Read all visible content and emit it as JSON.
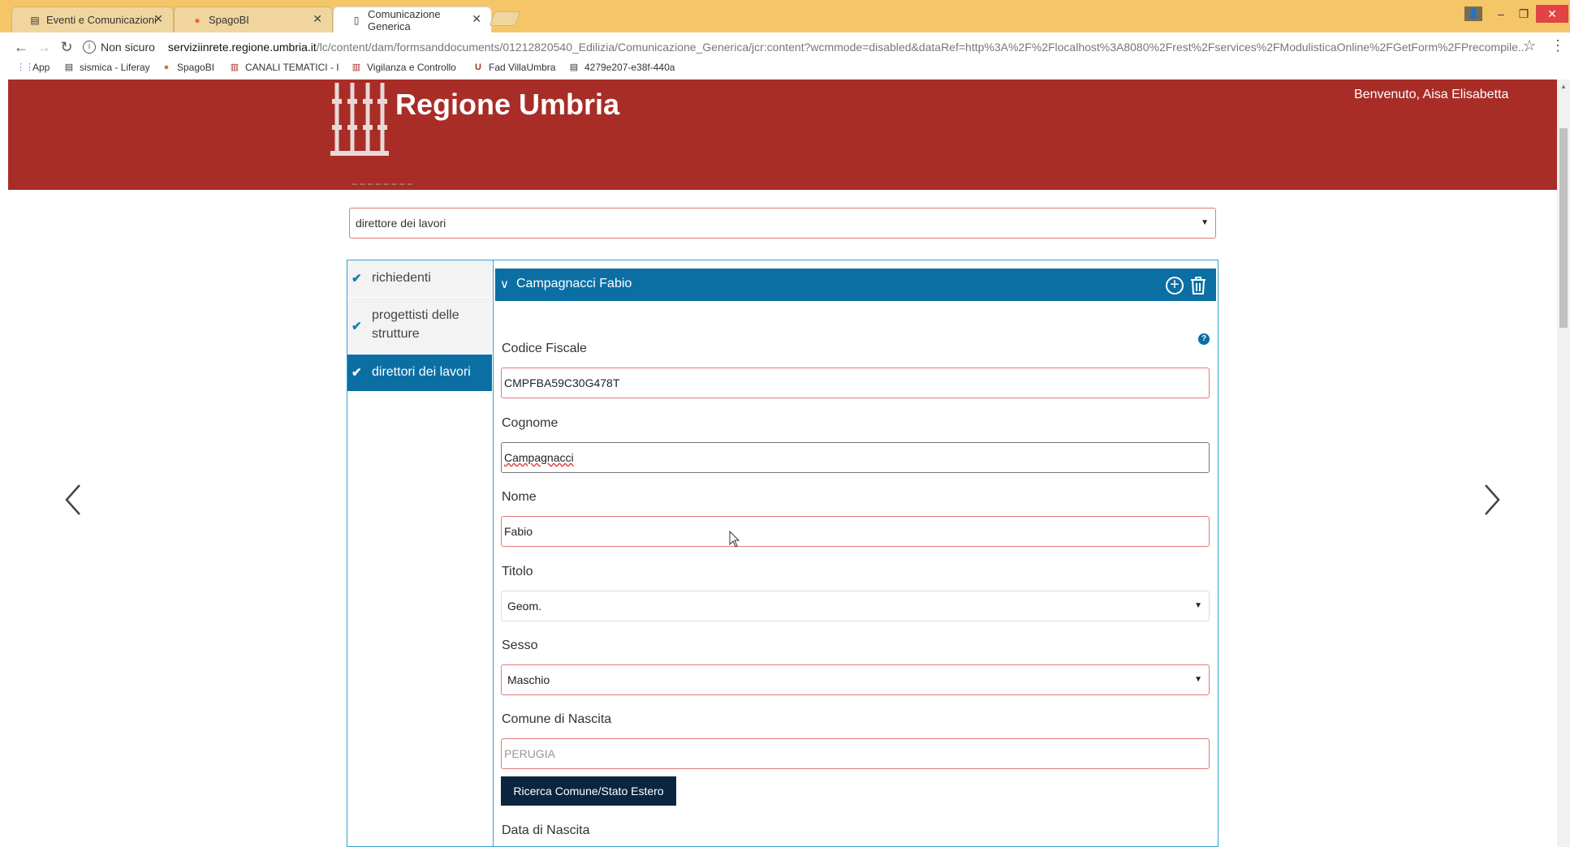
{
  "browser": {
    "tabs": [
      {
        "title": "Eventi e Comunicazioni",
        "icon": "page-icon"
      },
      {
        "title": "SpagoBI",
        "icon": "spagobi-icon"
      },
      {
        "title": "Comunicazione Generica",
        "icon": "document-icon"
      }
    ],
    "address": {
      "security_label": "Non sicuro",
      "host": "serviziinrete.regione.umbria.it",
      "path": "/lc/content/dam/formsanddocuments/01212820540_Edilizia/Comunicazione_Generica/jcr:content?wcmmode=disabled&dataRef=http%3A%2F%2Flocalhost%3A8080%2Frest%2Fservices%2FModulisticaOnline%2FGetForm%2FPrecompile..."
    },
    "bookmarks": [
      {
        "label": "App",
        "icon": "apps-grid-icon"
      },
      {
        "label": "sismica - Liferay",
        "icon": "page-icon"
      },
      {
        "label": "SpagoBI",
        "icon": "spagobi-icon"
      },
      {
        "label": "CANALI TEMATICI - I",
        "icon": "regione-icon"
      },
      {
        "label": "Vigilanza e Controllo",
        "icon": "regione-icon"
      },
      {
        "label": "Fad VillaUmbra",
        "icon": "u-icon"
      },
      {
        "label": "4279e207-e38f-440a",
        "icon": "page-icon"
      }
    ]
  },
  "header": {
    "brand": "Regione Umbria",
    "welcome": "Benvenuto, Aisa Elisabetta"
  },
  "form": {
    "role_select": "direttore dei lavori",
    "sections": [
      {
        "label": "richiedenti",
        "active": false
      },
      {
        "label": "progettisti delle strutture",
        "active": false
      },
      {
        "label": "direttori dei lavori",
        "active": true
      }
    ],
    "panel_title": "Campagnacci Fabio",
    "help_icon_text": "?",
    "fields": {
      "codice_fiscale": {
        "label": "Codice Fiscale",
        "value": "CMPFBA59C30G478T"
      },
      "cognome": {
        "label": "Cognome",
        "value": "Campagnacci"
      },
      "nome": {
        "label": "Nome",
        "value": "Fabio"
      },
      "titolo": {
        "label": "Titolo",
        "value": "Geom."
      },
      "sesso": {
        "label": "Sesso",
        "value": "Maschio"
      },
      "comune_nascita": {
        "label": "Comune di Nascita",
        "value": "PERUGIA"
      },
      "data_nascita": {
        "label": "Data di Nascita"
      }
    },
    "search_button": "Ricerca Comune/Stato Estero"
  },
  "colors": {
    "header_red": "#a82d27",
    "accent_blue": "#0b6fa4",
    "tabstrip": "#f5c668",
    "error_border": "#e07a7a",
    "button_dark": "#0a2540"
  }
}
